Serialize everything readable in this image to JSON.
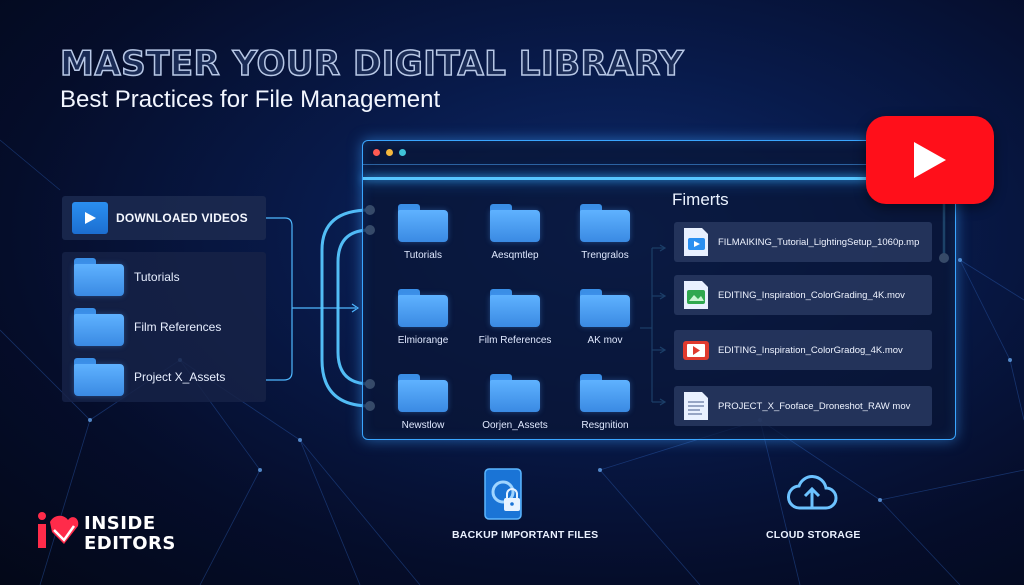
{
  "hero": {
    "title": "MASTER YOUR DIGITAL LIBRARY",
    "subtitle": "Best Practices for File Management"
  },
  "sidebar": {
    "header_label": "DOWNLOAED VIDEOS",
    "items": [
      {
        "label": "Tutorials",
        "icon": "folder-icon"
      },
      {
        "label": "Film References",
        "icon": "folder-icon"
      },
      {
        "label": "Project X_Assets",
        "icon": "folder-icon"
      }
    ]
  },
  "window": {
    "folders": [
      {
        "label": "Tutorials"
      },
      {
        "label": "Aesqmtlep"
      },
      {
        "label": "Trengralos"
      },
      {
        "label": "Elmiorange"
      },
      {
        "label": "Film References"
      },
      {
        "label": "AK mov"
      },
      {
        "label": "Newstlow"
      },
      {
        "label": "Oorjen_Assets"
      },
      {
        "label": "Resgnition"
      }
    ],
    "files_title": "Fimerts",
    "files": [
      {
        "name": "FILMAIKING_Tutorial_LightingSetup_1060p.mp",
        "icon": "video-file-icon"
      },
      {
        "name": "EDITING_Inspiration_ColorGrading_4K.mov",
        "icon": "image-file-icon"
      },
      {
        "name": "EDITING_Inspiration_ColorGradog_4K.mov",
        "icon": "play-file-icon"
      },
      {
        "name": "PROJECT_X_Fooface_Droneshot_RAW mov",
        "icon": "document-file-icon"
      }
    ]
  },
  "bottom": {
    "backup_label": "BACKUP IMPORTANT FILES",
    "cloud_label": "CLOUD STORAGE"
  },
  "brand": {
    "line1": "INSIDE",
    "line2": "EDITORS"
  },
  "colors": {
    "accent": "#3aa6ff",
    "folder": "#4a9ff0",
    "youtube": "#ff0f1a"
  }
}
